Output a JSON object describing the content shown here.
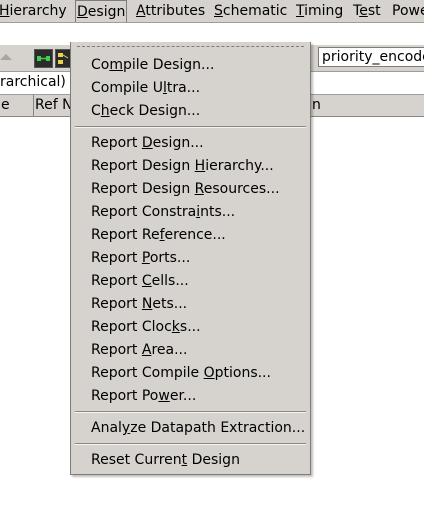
{
  "menubar": {
    "items": [
      {
        "pre": "",
        "key": "H",
        "post": "ierarchy"
      },
      {
        "pre": "",
        "key": "D",
        "post": "esign"
      },
      {
        "pre": "",
        "key": "A",
        "post": "ttributes"
      },
      {
        "pre": "",
        "key": "S",
        "post": "chematic"
      },
      {
        "pre": "",
        "key": "T",
        "post": "iming"
      },
      {
        "pre": "T",
        "key": "e",
        "post": "st"
      },
      {
        "pre": "Powe",
        "key": "",
        "post": ""
      }
    ]
  },
  "toolbar": {
    "design_value": "priority_encode"
  },
  "view": {
    "mode_value": "rarchical)"
  },
  "columns": {
    "col1": "e",
    "col2": "Ref N",
    "col3": "n"
  },
  "design_menu": {
    "items": [
      {
        "pre": "Co",
        "key": "m",
        "post": "pile Design..."
      },
      {
        "pre": "Compile U",
        "key": "l",
        "post": "tra..."
      },
      {
        "pre": "C",
        "key": "h",
        "post": "eck Design..."
      },
      {
        "pre": "Report ",
        "key": "D",
        "post": "esign..."
      },
      {
        "pre": "Report Design ",
        "key": "H",
        "post": "ierarchy..."
      },
      {
        "pre": "Report Design ",
        "key": "R",
        "post": "esources..."
      },
      {
        "pre": "Report Constra",
        "key": "i",
        "post": "nts..."
      },
      {
        "pre": "Report Re",
        "key": "f",
        "post": "erence..."
      },
      {
        "pre": "Report ",
        "key": "P",
        "post": "orts..."
      },
      {
        "pre": "Report ",
        "key": "C",
        "post": "ells..."
      },
      {
        "pre": "Report ",
        "key": "N",
        "post": "ets..."
      },
      {
        "pre": "Report Cloc",
        "key": "k",
        "post": "s..."
      },
      {
        "pre": "Report ",
        "key": "A",
        "post": "rea..."
      },
      {
        "pre": "Report Compile ",
        "key": "O",
        "post": "ptions..."
      },
      {
        "pre": "Report Po",
        "key": "w",
        "post": "er..."
      },
      {
        "pre": "Anal",
        "key": "y",
        "post": "ze Datapath Extraction..."
      },
      {
        "pre": "Reset Curren",
        "key": "t",
        "post": " Design"
      }
    ]
  }
}
